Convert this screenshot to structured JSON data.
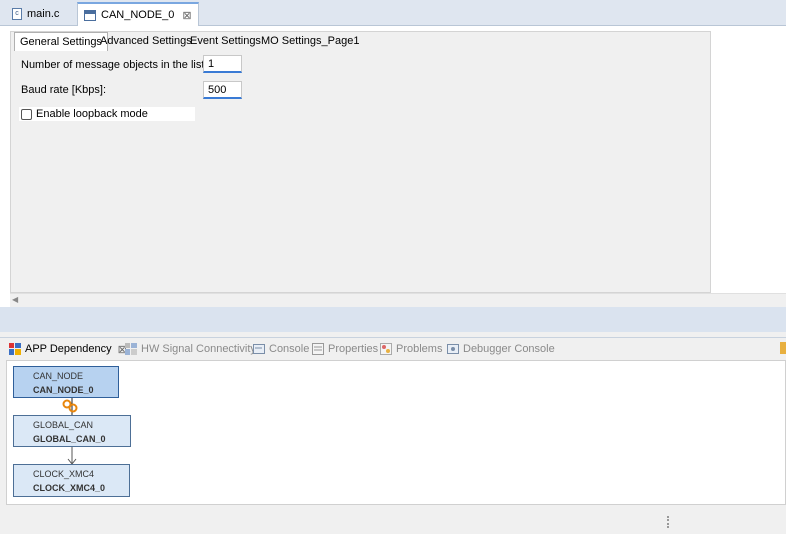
{
  "editor_tabs": [
    {
      "label": "main.c",
      "icon": "c-file-icon",
      "active": false
    },
    {
      "label": "CAN_NODE_0",
      "icon": "app-config-icon",
      "active": true,
      "close": "⊠"
    }
  ],
  "props_tabs": [
    "General Settings",
    "Advanced Settings",
    "Event Settings",
    "MO Settings_Page1"
  ],
  "general": {
    "msg_objects_label": "Number of message objects in the list:",
    "msg_objects_value": "1",
    "baud_label": "Baud rate [Kbps]:",
    "baud_value": "500",
    "loopback_label": "Enable loopback mode",
    "loopback_checked": false
  },
  "view_tabs": [
    {
      "label": "APP Dependency",
      "active": true,
      "icon": "app-dependency-icon",
      "close": "⊠"
    },
    {
      "label": "HW Signal Connectivity",
      "active": false,
      "icon": "hw-signal-icon"
    },
    {
      "label": "Console",
      "active": false,
      "icon": "console-icon"
    },
    {
      "label": "Properties",
      "active": false,
      "icon": "properties-icon"
    },
    {
      "label": "Problems",
      "active": false,
      "icon": "problems-icon"
    },
    {
      "label": "Debugger Console",
      "active": false,
      "icon": "debugger-console-icon"
    }
  ],
  "dependency_nodes": [
    {
      "type": "CAN_NODE",
      "instance": "CAN_NODE_0",
      "selected": true
    },
    {
      "type": "GLOBAL_CAN",
      "instance": "GLOBAL_CAN_0",
      "selected": false
    },
    {
      "type": "CLOCK_XMC4",
      "instance": "CLOCK_XMC4_0",
      "selected": false
    }
  ],
  "colors": {
    "accent": "#3a7bd5",
    "node_fill": "#dbe8f6",
    "connector": "#e8860c"
  }
}
